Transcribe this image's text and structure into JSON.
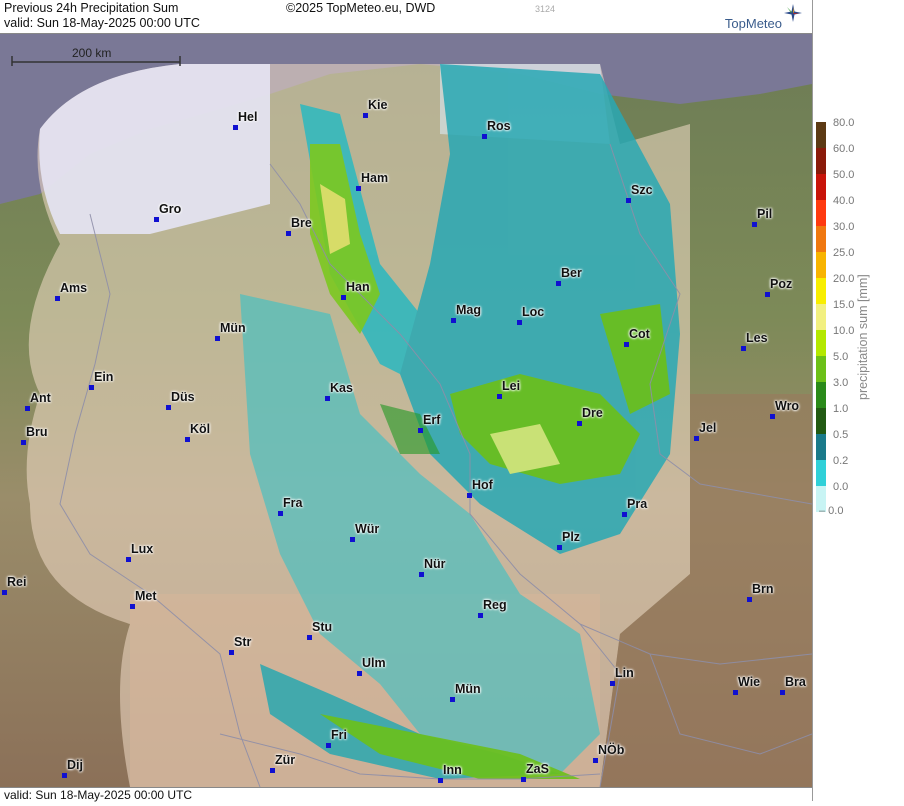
{
  "header": {
    "title": "Previous 24h Precipitation Sum",
    "valid_line": "valid:  Sun  18-May-2025 00:00 UTC",
    "copyright": "©2025 TopMeteo.eu, DWD",
    "run_id": "3124",
    "logo_text": "TopMeteo",
    "logo_icon": "compass-star-icon"
  },
  "footer": {
    "valid_line": "valid:  Sun  18-May-2025 00:00 UTC"
  },
  "scale_bar": {
    "label": "200 km"
  },
  "legend": {
    "title": "precipitation sum [mm]",
    "entries": [
      {
        "label": "80.0",
        "color": "#5c3a14"
      },
      {
        "label": "60.0",
        "color": "#8a1a0a"
      },
      {
        "label": "50.0",
        "color": "#c8140a"
      },
      {
        "label": "40.0",
        "color": "#ff3a10"
      },
      {
        "label": "30.0",
        "color": "#f07810"
      },
      {
        "label": "25.0",
        "color": "#f8b400"
      },
      {
        "label": "20.0",
        "color": "#f8ee00"
      },
      {
        "label": "15.0",
        "color": "#f2f080"
      },
      {
        "label": "10.0",
        "color": "#b4e800"
      },
      {
        "label": "5.0",
        "color": "#6cc018"
      },
      {
        "label": "3.0",
        "color": "#2a8a1a"
      },
      {
        "label": "1.0",
        "color": "#225a14"
      },
      {
        "label": "0.5",
        "color": "#1a7a8a"
      },
      {
        "label": "0.2",
        "color": "#30d0d8"
      },
      {
        "label": "0.0",
        "color": "#c8f4f4"
      }
    ],
    "zero_label": "0.0"
  },
  "cities": [
    {
      "name": "Kie"
    },
    {
      "name": "Hel"
    },
    {
      "name": "Ros"
    },
    {
      "name": "Ham"
    },
    {
      "name": "Szc"
    },
    {
      "name": "Gro"
    },
    {
      "name": "Bre"
    },
    {
      "name": "Pil"
    },
    {
      "name": "Ber"
    },
    {
      "name": "Ams"
    },
    {
      "name": "Han"
    },
    {
      "name": "Poz"
    },
    {
      "name": "Mag"
    },
    {
      "name": "Loc"
    },
    {
      "name": "Mün"
    },
    {
      "name": "Cot"
    },
    {
      "name": "Les"
    },
    {
      "name": "Ein"
    },
    {
      "name": "Lei"
    },
    {
      "name": "Kas"
    },
    {
      "name": "Ant"
    },
    {
      "name": "Düs"
    },
    {
      "name": "Wro"
    },
    {
      "name": "Dre"
    },
    {
      "name": "Bru"
    },
    {
      "name": "Erf"
    },
    {
      "name": "Köl"
    },
    {
      "name": "Jel"
    },
    {
      "name": "Hof"
    },
    {
      "name": "Fra"
    },
    {
      "name": "Pra"
    },
    {
      "name": "Wür"
    },
    {
      "name": "Plz"
    },
    {
      "name": "Lux"
    },
    {
      "name": "Nür"
    },
    {
      "name": "Rei"
    },
    {
      "name": "Met"
    },
    {
      "name": "Reg"
    },
    {
      "name": "Brn"
    },
    {
      "name": "Stu"
    },
    {
      "name": "Str"
    },
    {
      "name": "Ulm"
    },
    {
      "name": "Lin"
    },
    {
      "name": "Mün"
    },
    {
      "name": "Wie"
    },
    {
      "name": "Bra"
    },
    {
      "name": "Fri"
    },
    {
      "name": "NÖb"
    },
    {
      "name": "Dij"
    },
    {
      "name": "Zür"
    },
    {
      "name": "Inn"
    },
    {
      "name": "ZaS"
    }
  ]
}
